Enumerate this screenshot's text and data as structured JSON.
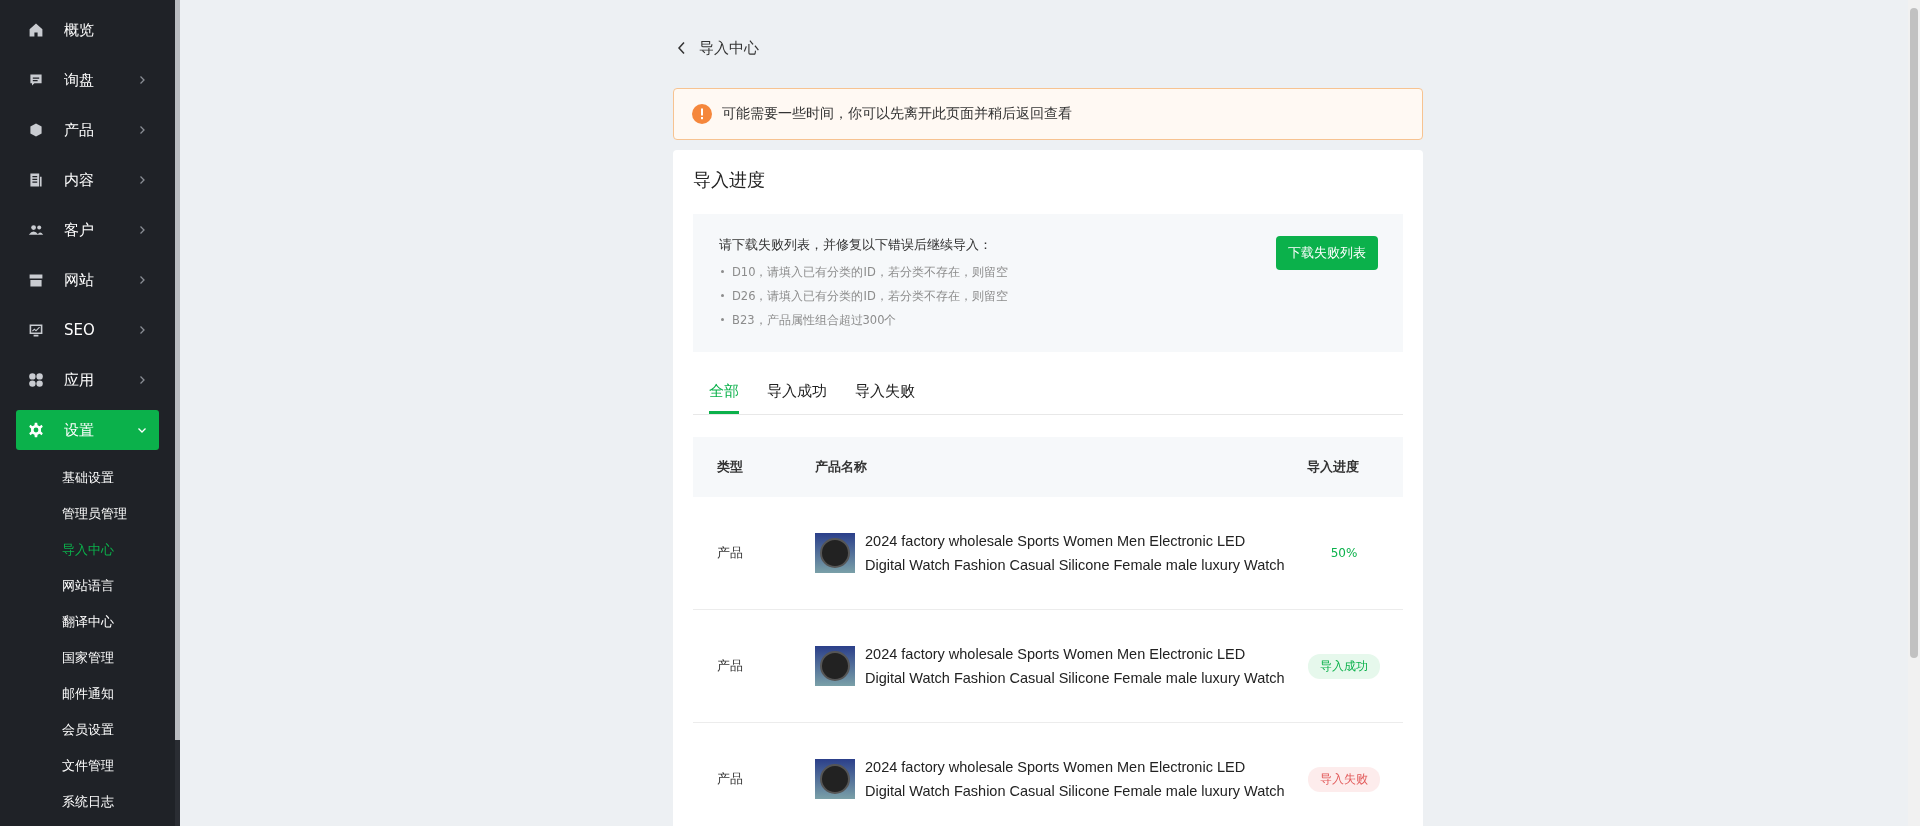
{
  "sidebar": {
    "items": [
      {
        "label": "概览",
        "kind": "link",
        "selected": false
      },
      {
        "label": "询盘",
        "kind": "group",
        "expanded": false,
        "selected": false
      },
      {
        "label": "产品",
        "kind": "group",
        "expanded": false,
        "selected": false
      },
      {
        "label": "内容",
        "kind": "group",
        "expanded": false,
        "selected": false
      },
      {
        "label": "客户",
        "kind": "group",
        "expanded": false,
        "selected": false
      },
      {
        "label": "网站",
        "kind": "group",
        "expanded": false,
        "selected": false
      },
      {
        "label": "SEO",
        "kind": "group",
        "expanded": false,
        "selected": false
      },
      {
        "label": "应用",
        "kind": "group",
        "expanded": false,
        "selected": false
      },
      {
        "label": "设置",
        "kind": "group",
        "expanded": true,
        "selected": true,
        "children": [
          {
            "label": "基础设置",
            "selected": false
          },
          {
            "label": "管理员管理",
            "selected": false
          },
          {
            "label": "导入中心",
            "selected": true
          },
          {
            "label": "网站语言",
            "selected": false
          },
          {
            "label": "翻译中心",
            "selected": false
          },
          {
            "label": "国家管理",
            "selected": false
          },
          {
            "label": "邮件通知",
            "selected": false
          },
          {
            "label": "会员设置",
            "selected": false
          },
          {
            "label": "文件管理",
            "selected": false
          },
          {
            "label": "系统日志",
            "selected": false
          }
        ]
      }
    ]
  },
  "page_title": "导入中心",
  "alert": "可能需要一些时间，你可以先离开此页面并稍后返回查看",
  "card": {
    "title": "导入进度",
    "errors": {
      "heading": "请下载失败列表，并修复以下错误后继续导入：",
      "items": [
        "D10，请填入已有分类的ID，若分类不存在，则留空",
        "D26，请填入已有分类的ID，若分类不存在，则留空",
        "B23，产品属性组合超过300个"
      ],
      "button": "下载失败列表"
    },
    "tabs": [
      {
        "label": "全部",
        "selected": true
      },
      {
        "label": "导入成功",
        "selected": false
      },
      {
        "label": "导入失败",
        "selected": false
      }
    ],
    "table": {
      "columns": [
        "类型",
        "产品名称",
        "导入进度"
      ],
      "rows": [
        {
          "type": "产品",
          "name": "2024 factory wholesale Sports Women Men Electronic LED Digital Watch Fashion Casual Silicone Female male luxury Watch",
          "status": {
            "kind": "progress",
            "text": "50%"
          }
        },
        {
          "type": "产品",
          "name": "2024 factory wholesale Sports Women Men Electronic LED Digital Watch Fashion Casual Silicone Female male luxury Watch",
          "status": {
            "kind": "success",
            "text": "导入成功"
          }
        },
        {
          "type": "产品",
          "name": "2024 factory wholesale Sports Women Men Electronic LED Digital Watch Fashion Casual Silicone Female male luxury Watch",
          "status": {
            "kind": "failed",
            "text": "导入失败"
          }
        }
      ]
    }
  }
}
